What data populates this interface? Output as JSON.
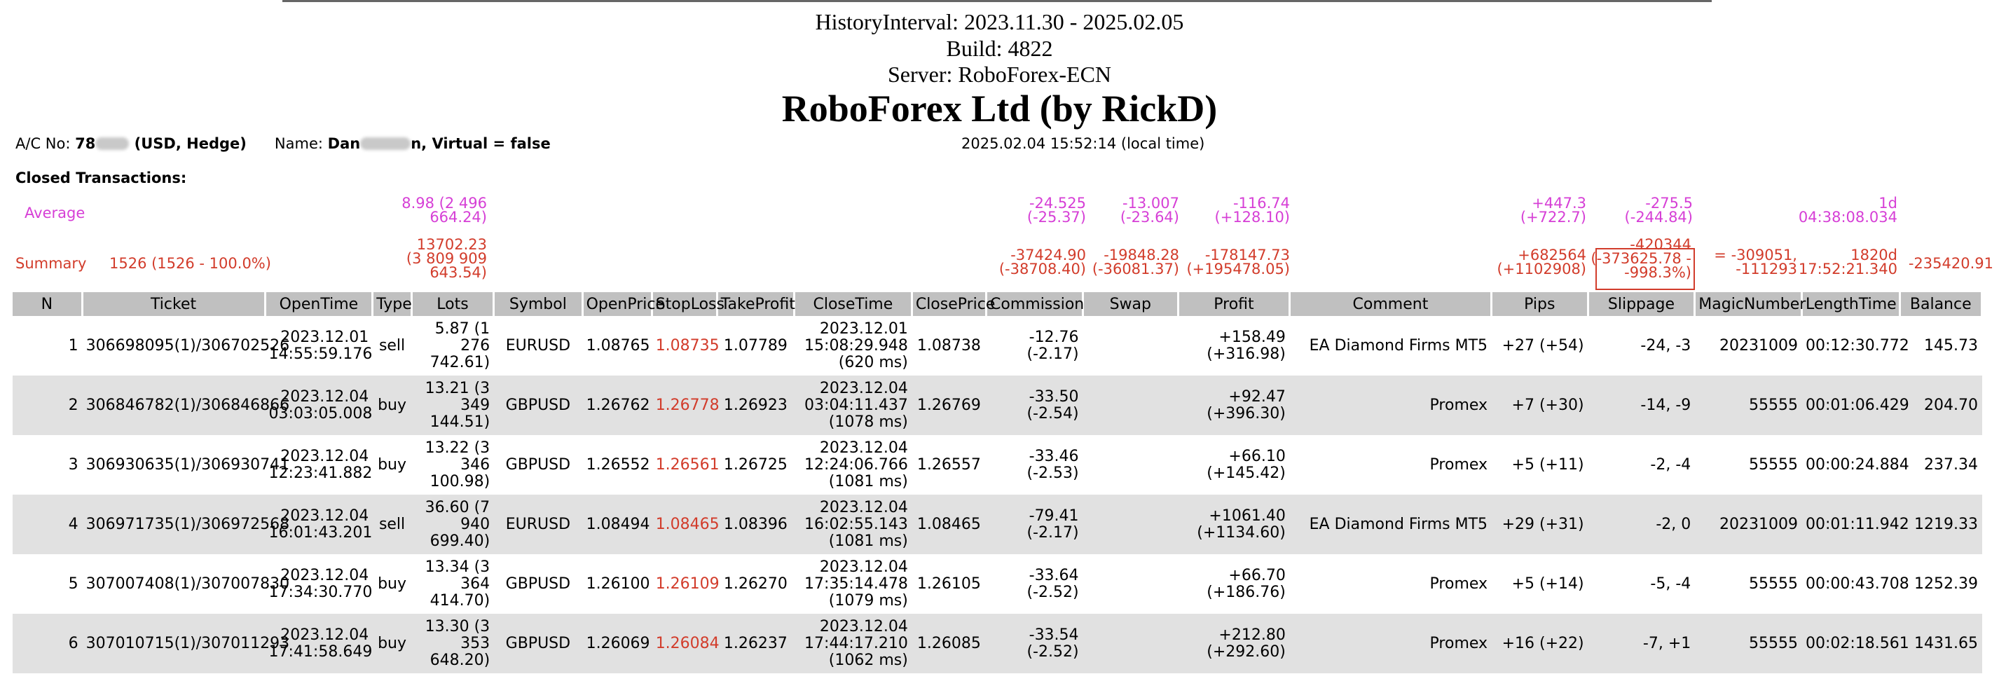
{
  "header": {
    "history_interval": "HistoryInterval: 2023.11.30 - 2025.02.05",
    "build": "Build: 4822",
    "server": "Server: RoboForex-ECN",
    "broker": "RoboForex Ltd (by RickD)"
  },
  "account": {
    "ac_label": "A/C No: ",
    "ac_prefix": "78",
    "ac_suffix": " (USD, Hedge)",
    "name_label": "Name: ",
    "name_prefix": "Dan",
    "name_suffix": "n, Virtual = false",
    "local_time": "2025.02.04 15:52:14 (local time)"
  },
  "closed_title": "Closed Transactions:",
  "average": {
    "label": "Average",
    "lots": [
      "8.98 (2 496",
      "664.24)"
    ],
    "commission": [
      "-24.525",
      "(-25.37)"
    ],
    "swap": [
      "-13.007",
      "(-23.64)"
    ],
    "profit": [
      "-116.74",
      "(+128.10)"
    ],
    "pips": [
      "+447.3",
      "(+722.7)"
    ],
    "slippage": [
      "-275.5",
      "(-244.84)"
    ],
    "length": [
      "1d",
      "04:38:08.034"
    ]
  },
  "summary": {
    "label": "Summary",
    "count": "1526 (1526 - 100.0%)",
    "lots": [
      "13702.23",
      "(3 809 909",
      "643.54)"
    ],
    "commission": [
      "-37424.90",
      "(-38708.40)"
    ],
    "swap": [
      "-19848.28",
      "(-36081.37)"
    ],
    "profit": [
      "-178147.73",
      "(+195478.05)"
    ],
    "pips": [
      "+682564",
      "(+1102908)"
    ],
    "slippage": [
      "-420344",
      "(-373625.78 -",
      "-998.3%)"
    ],
    "magic": [
      "= -309051,",
      "-111293"
    ],
    "length": [
      "1820d",
      "17:52:21.340"
    ],
    "balance": "-235420.91"
  },
  "columns": [
    "N",
    "Ticket",
    "OpenTime",
    "Type",
    "Lots",
    "Symbol",
    "OpenPrice",
    "StopLoss",
    "TakeProfit",
    "CloseTime",
    "ClosePrice",
    "Commission",
    "Swap",
    "Profit",
    "Comment",
    "Pips",
    "Slippage",
    "MagicNumber",
    "LengthTime",
    "Balance"
  ],
  "rows": [
    {
      "n": "1",
      "ticket": "306698095(1)/306702526",
      "open_date": "2023.12.01",
      "open_time": "14:55:59.176",
      "type": "sell",
      "lots1": "5.87 (1 276",
      "lots2": "742.61)",
      "lots3": "",
      "symbol": "EURUSD",
      "open_price": "1.08765",
      "stop_loss": "1.08735",
      "take_profit": "1.07789",
      "close_date": "2023.12.01",
      "close_time": "15:08:29.948",
      "close_ms": "(620 ms)",
      "close_price": "1.08738",
      "comm1": "-12.76",
      "comm2": "(-2.17)",
      "swap": "",
      "profit1": "+158.49",
      "profit2": "(+316.98)",
      "comment": "EA Diamond Firms MT5",
      "pips": "+27 (+54)",
      "slippage": "-24, -3",
      "magic": "20231009",
      "length": "00:12:30.772",
      "balance": "145.73"
    },
    {
      "n": "2",
      "ticket": "306846782(1)/306846866",
      "open_date": "2023.12.04",
      "open_time": "03:03:05.008",
      "type": "buy",
      "lots1": "13.21 (3",
      "lots2": "349",
      "lots3": "144.51)",
      "symbol": "GBPUSD",
      "open_price": "1.26762",
      "stop_loss": "1.26778",
      "take_profit": "1.26923",
      "close_date": "2023.12.04",
      "close_time": "03:04:11.437",
      "close_ms": "(1078 ms)",
      "close_price": "1.26769",
      "comm1": "-33.50",
      "comm2": "(-2.54)",
      "swap": "",
      "profit1": "+92.47",
      "profit2": "(+396.30)",
      "comment": "Promex",
      "pips": "+7 (+30)",
      "slippage": "-14, -9",
      "magic": "55555",
      "length": "00:01:06.429",
      "balance": "204.70"
    },
    {
      "n": "3",
      "ticket": "306930635(1)/306930741",
      "open_date": "2023.12.04",
      "open_time": "12:23:41.882",
      "type": "buy",
      "lots1": "13.22 (3",
      "lots2": "346",
      "lots3": "100.98)",
      "symbol": "GBPUSD",
      "open_price": "1.26552",
      "stop_loss": "1.26561",
      "take_profit": "1.26725",
      "close_date": "2023.12.04",
      "close_time": "12:24:06.766",
      "close_ms": "(1081 ms)",
      "close_price": "1.26557",
      "comm1": "-33.46",
      "comm2": "(-2.53)",
      "swap": "",
      "profit1": "+66.10",
      "profit2": "(+145.42)",
      "comment": "Promex",
      "pips": "+5 (+11)",
      "slippage": "-2, -4",
      "magic": "55555",
      "length": "00:00:24.884",
      "balance": "237.34"
    },
    {
      "n": "4",
      "ticket": "306971735(1)/306972568",
      "open_date": "2023.12.04",
      "open_time": "16:01:43.201",
      "type": "sell",
      "lots1": "36.60 (7",
      "lots2": "940",
      "lots3": "699.40)",
      "symbol": "EURUSD",
      "open_price": "1.08494",
      "stop_loss": "1.08465",
      "take_profit": "1.08396",
      "close_date": "2023.12.04",
      "close_time": "16:02:55.143",
      "close_ms": "(1081 ms)",
      "close_price": "1.08465",
      "comm1": "-79.41",
      "comm2": "(-2.17)",
      "swap": "",
      "profit1": "+1061.40",
      "profit2": "(+1134.60)",
      "comment": "EA Diamond Firms MT5",
      "pips": "+29 (+31)",
      "slippage": "-2, 0",
      "magic": "20231009",
      "length": "00:01:11.942",
      "balance": "1219.33"
    },
    {
      "n": "5",
      "ticket": "307007408(1)/307007830",
      "open_date": "2023.12.04",
      "open_time": "17:34:30.770",
      "type": "buy",
      "lots1": "13.34 (3",
      "lots2": "364",
      "lots3": "414.70)",
      "symbol": "GBPUSD",
      "open_price": "1.26100",
      "stop_loss": "1.26109",
      "take_profit": "1.26270",
      "close_date": "2023.12.04",
      "close_time": "17:35:14.478",
      "close_ms": "(1079 ms)",
      "close_price": "1.26105",
      "comm1": "-33.64",
      "comm2": "(-2.52)",
      "swap": "",
      "profit1": "+66.70",
      "profit2": "(+186.76)",
      "comment": "Promex",
      "pips": "+5 (+14)",
      "slippage": "-5, -4",
      "magic": "55555",
      "length": "00:00:43.708",
      "balance": "1252.39"
    },
    {
      "n": "6",
      "ticket": "307010715(1)/307011293",
      "open_date": "2023.12.04",
      "open_time": "17:41:58.649",
      "type": "buy",
      "lots1": "13.30 (3",
      "lots2": "353",
      "lots3": "648.20)",
      "symbol": "GBPUSD",
      "open_price": "1.26069",
      "stop_loss": "1.26084",
      "take_profit": "1.26237",
      "close_date": "2023.12.04",
      "close_time": "17:44:17.210",
      "close_ms": "(1062 ms)",
      "close_price": "1.26085",
      "comm1": "-33.54",
      "comm2": "(-2.52)",
      "swap": "",
      "profit1": "+212.80",
      "profit2": "(+292.60)",
      "comment": "Promex",
      "pips": "+16 (+22)",
      "slippage": "-7, +1",
      "magic": "55555",
      "length": "00:02:18.561",
      "balance": "1431.65"
    }
  ],
  "colors": {
    "magenta": "#d63fd6",
    "red": "#d23c2b",
    "header_bg": "#c0c0c0",
    "alt_row_bg": "#e1e1e1"
  }
}
